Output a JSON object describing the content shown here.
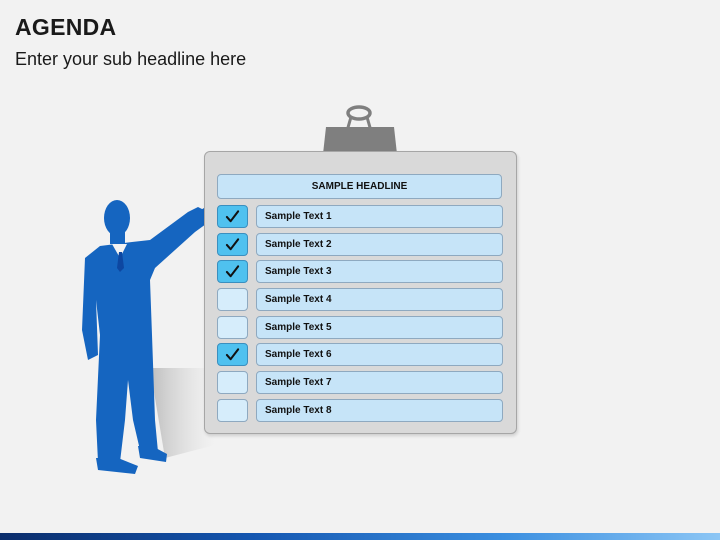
{
  "slide": {
    "title": "AGENDA",
    "subtitle": "Enter your sub headline here"
  },
  "board": {
    "headline": "SAMPLE HEADLINE",
    "items": [
      {
        "label": "Sample Text 1",
        "checked": true
      },
      {
        "label": "Sample Text 2",
        "checked": true
      },
      {
        "label": "Sample Text 3",
        "checked": true
      },
      {
        "label": "Sample Text 4",
        "checked": false
      },
      {
        "label": "Sample Text 5",
        "checked": false
      },
      {
        "label": "Sample Text 6",
        "checked": true
      },
      {
        "label": "Sample Text 7",
        "checked": false
      },
      {
        "label": "Sample Text 8",
        "checked": false
      }
    ]
  },
  "colors": {
    "presenter": "#1565c0",
    "check_filled": "#4fc1ef",
    "bar_fill": "#c6e4f8",
    "board": "#d9d9d9",
    "clip": "#7f7f7f"
  },
  "icons": {
    "check": "check-icon",
    "clip": "binder-clip-icon",
    "presenter": "presenter-silhouette-icon"
  }
}
